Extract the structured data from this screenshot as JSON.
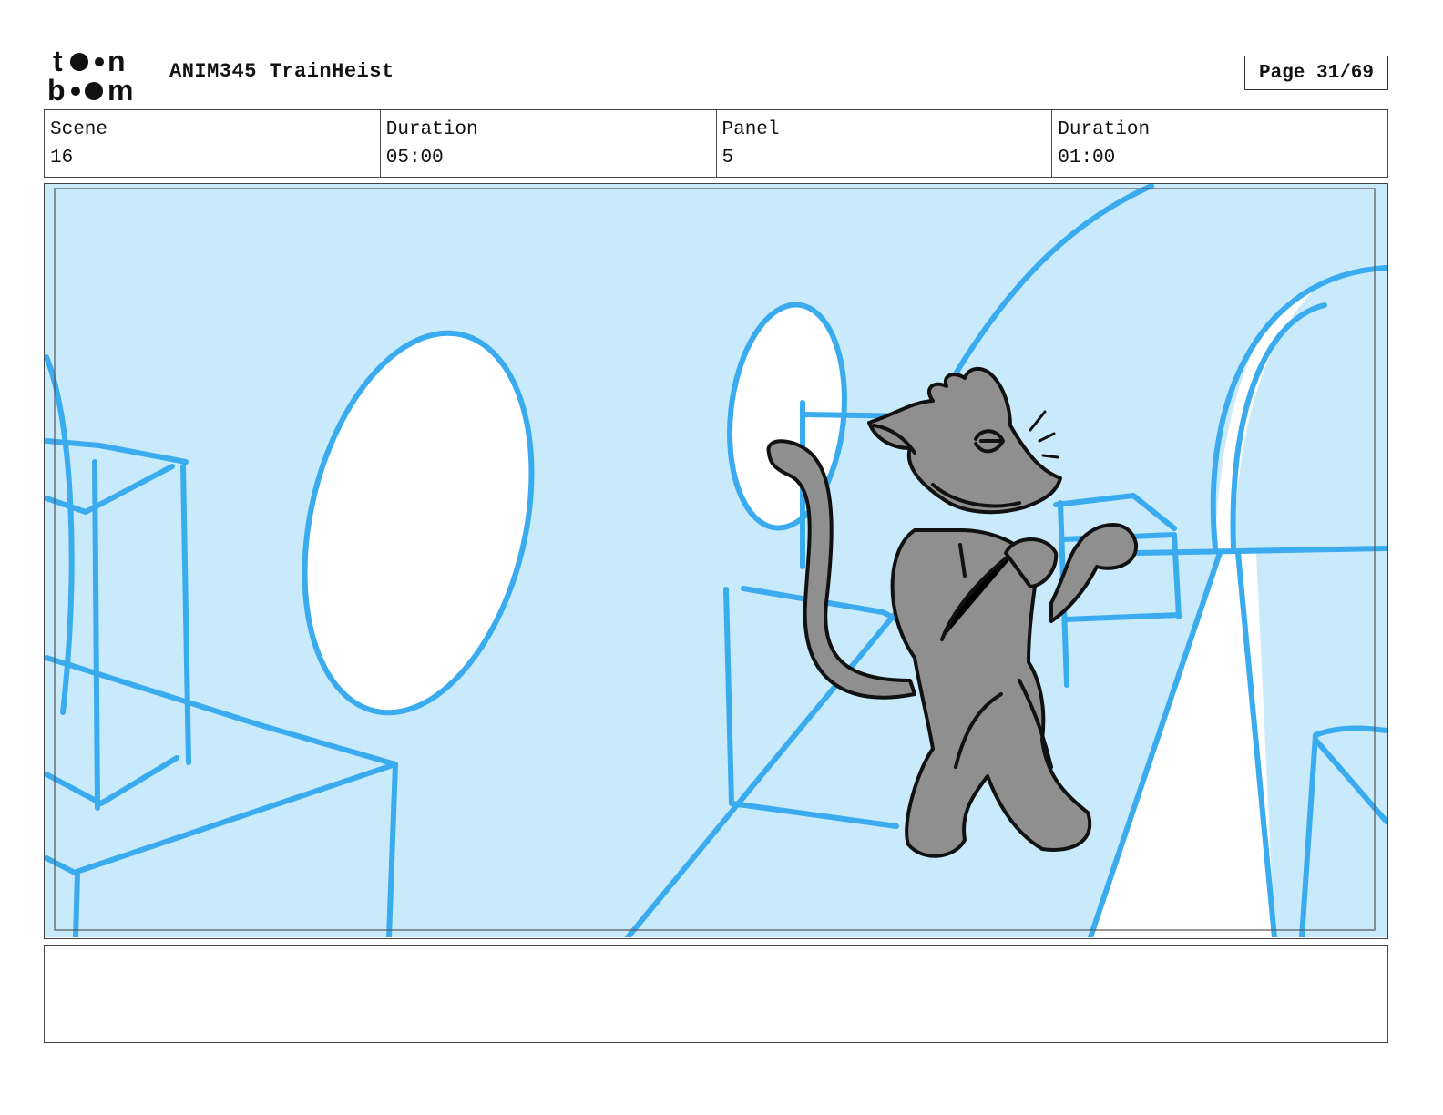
{
  "header": {
    "logo_text": "toon boom",
    "project_title": "ANIM345 TrainHeist",
    "page_label": "Page 31/69"
  },
  "info": {
    "scene_label": "Scene",
    "scene_value": "16",
    "scene_duration_label": "Duration",
    "scene_duration_value": "05:00",
    "panel_label": "Panel",
    "panel_value": "5",
    "panel_duration_label": "Duration",
    "panel_duration_value": "01:00"
  },
  "panel": {
    "background_color": "#c9eafb",
    "sketch_color": "#3aabee",
    "character_fill": "#8f8f8f",
    "character_line": "#111111"
  },
  "notes": {
    "text": ""
  }
}
